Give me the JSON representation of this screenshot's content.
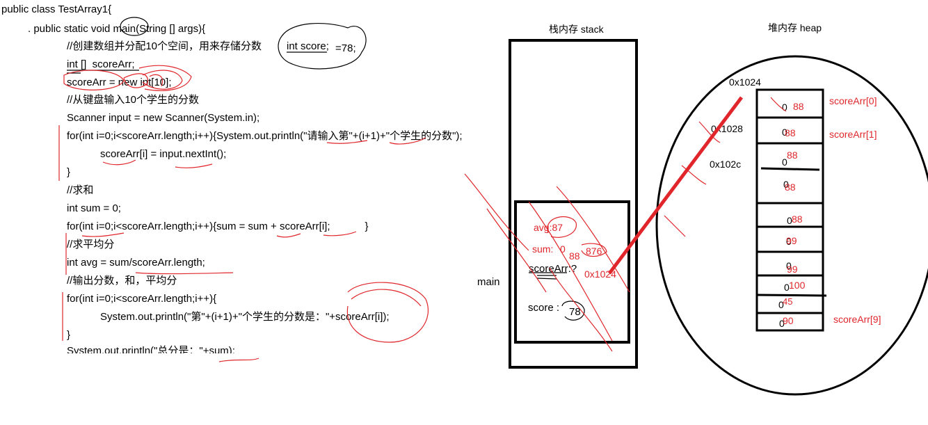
{
  "code": [
    "public class TestArray1{",
    ". public static void main(String [] args){",
    "//创建数组并分配10个空间，用来存储分数",
    "int []  scoreArr;",
    "scoreArr = new int[10];",
    "//从键盘输入10个学生的分数",
    "Scanner input = new Scanner(System.in);",
    "for(int i=0;i<scoreArr.length;i++){System.out.println(\"请输入第\"+(i+1)+\"个学生的分数\");",
    "scoreArr[i] = input.nextInt();",
    "}",
    "//求和",
    "int sum = 0;",
    "for(int i=0;i<scoreArr.length;i++){sum = sum + scoreArr[i];            }",
    "//求平均分",
    "int avg = sum/scoreArr.length;",
    "//输出分数，和，平均分",
    "for(int i=0;i<scoreArr.length;i++){",
    "System.out.println(\"第\"+(i+1)+\"个学生的分数是：\"+scoreArr[i]);",
    "}",
    "System.out.println(\"总分是：\"+sum);"
  ],
  "note_int_score": "int score;",
  "note_eq78": "=78;",
  "stack": {
    "title": "栈内存 stack",
    "frame_label": "main",
    "avg": "avg:87",
    "sum": "sum:",
    "sum_vals": [
      "0",
      "88",
      "876"
    ],
    "scorearr": "scoreArr:?",
    "scorearr_ref": "0x1024",
    "score": "score :",
    "score_val": "78"
  },
  "heap": {
    "title": "堆内存 heap",
    "addr_0": "0x1024",
    "addr_1": "0x1028",
    "addr_2": "0x102c",
    "label_first": "scoreArr[0]",
    "label_second": "scoreArr[1]",
    "label_last": "scoreArr[9]",
    "cells": [
      {
        "init": "0",
        "val": "88"
      },
      {
        "init": "0",
        "val": "88"
      },
      {
        "init": "0",
        "val": "88"
      },
      {
        "init": "0",
        "val": "88"
      },
      {
        "init": "0",
        "val": "88"
      },
      {
        "init": "0",
        "val": "99"
      },
      {
        "init": "0",
        "val": "99"
      },
      {
        "init": "0",
        "val": "100"
      },
      {
        "init": "0",
        "val": "45"
      },
      {
        "init": "0",
        "val": "90"
      }
    ]
  },
  "colors": {
    "annotation": "#e0262b",
    "ink": "#000000"
  }
}
